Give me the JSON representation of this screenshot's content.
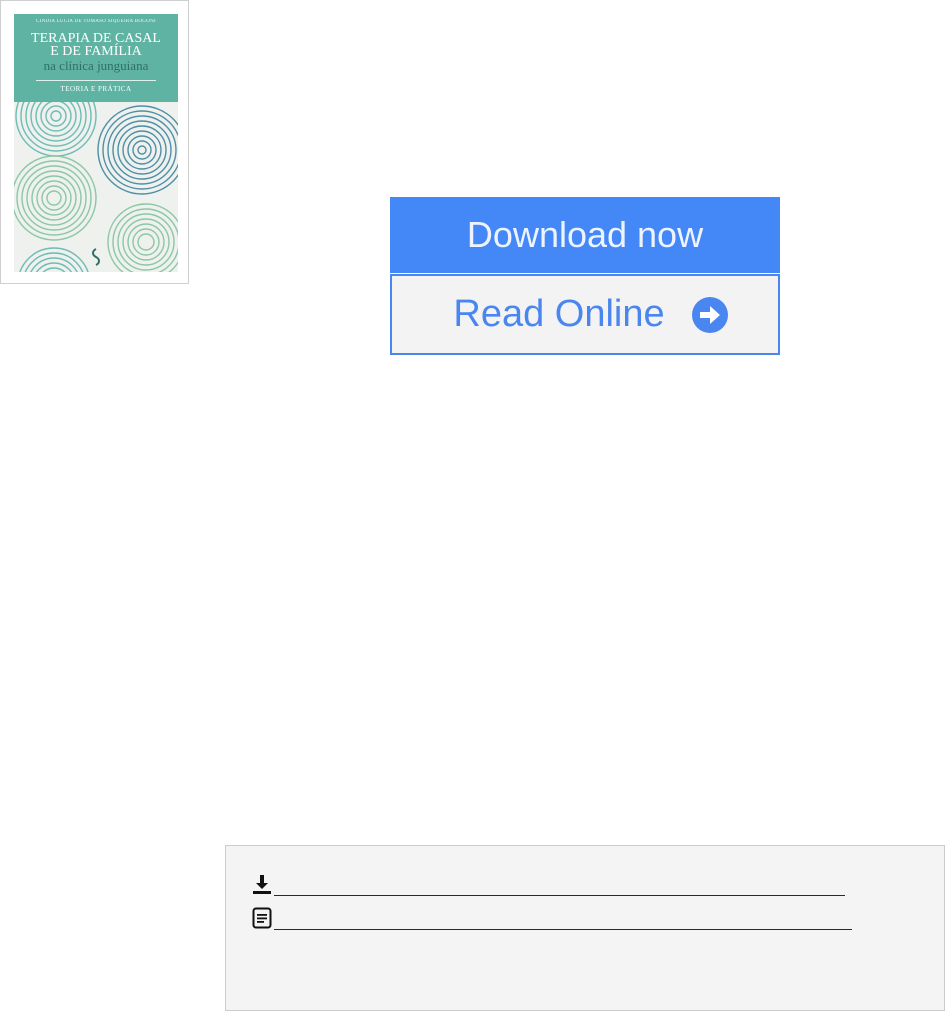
{
  "book": {
    "cover_author": "CINDIA LUCIA DE TOMASO SIQUEIRA BOGONI",
    "cover_title_line1": "TERAPIA DE CASAL",
    "cover_title_line2": "E DE FAMÍLIA",
    "cover_subtitle": "na clínica junguiana",
    "cover_tagline": "TEORIA E PRÁTICA",
    "cover_colors": {
      "header": "#5fb3a3",
      "circle_blue": "#4f8fa6",
      "circle_green": "#8cc7a6",
      "circle_teal": "#6fbcb4"
    }
  },
  "actions": {
    "download_label": "Download now",
    "read_online_label": "Read Online",
    "download_color": "#4488f8",
    "read_online_color": "#4a86f0"
  },
  "links": {
    "download_icon": "download-icon",
    "document_icon": "document-icon",
    "download_link_text": "",
    "read_link_text": ""
  }
}
